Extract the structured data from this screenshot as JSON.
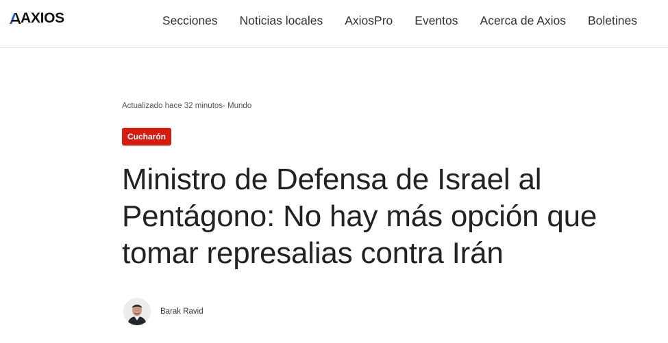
{
  "header": {
    "logo_text": "AXIOS",
    "nav": [
      {
        "label": "Secciones"
      },
      {
        "label": "Noticias locales"
      },
      {
        "label": "AxiosPro"
      },
      {
        "label": "Eventos"
      },
      {
        "label": "Acerca de Axios"
      },
      {
        "label": "Boletines"
      }
    ]
  },
  "article": {
    "meta": "Actualizado hace 32 minutos- Mundo",
    "tag": "Cucharón",
    "headline": "Ministro de Defensa de Israel al Pentágono: No hay más opción que tomar represalias contra Irán",
    "author": "Barak Ravid"
  },
  "colors": {
    "tag_background": "#d31d10",
    "logo_accent": "#1a5ad7"
  }
}
